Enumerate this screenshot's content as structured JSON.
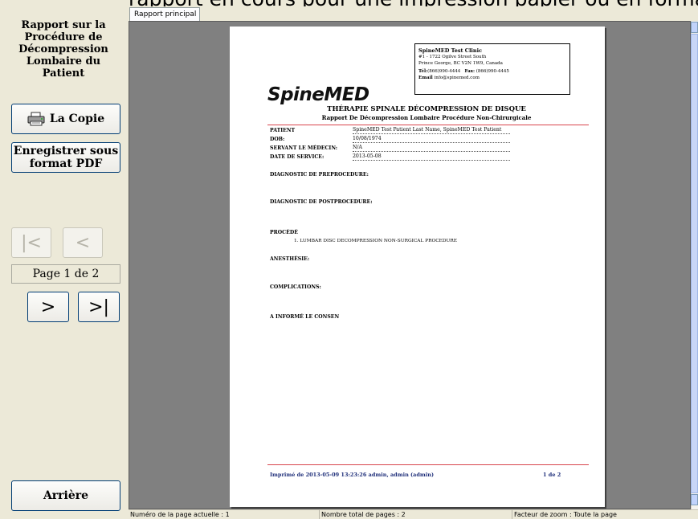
{
  "header": {
    "banner_text": "rapport en cours pour une impression papier ou en format PDF"
  },
  "sidebar": {
    "title": "Rapport sur la Procédure de Décompression Lombaire du Patient",
    "copy_label": "La Copie",
    "pdf_label": "Enregistrer sous format PDF",
    "first_label": "|<",
    "prev_label": "<",
    "page_indicator": "Page 1 de 2",
    "next_label": ">",
    "last_label": ">|",
    "back_label": "Arrière"
  },
  "tabs": [
    {
      "label": "Rapport principal"
    }
  ],
  "report": {
    "clinic": {
      "name": "SpineMED Test Clinic",
      "address1": "#1 - 1722 Ogilve Street South",
      "address2": "Prince George, BC V2N 1W9, Canada",
      "tel_label": "Tél:",
      "tel": "(866)990-4444",
      "fax_label": "Fax:",
      "fax": "(866)990-4445",
      "email_label": "Email",
      "email": "info@spinemed.com"
    },
    "logo_text": "SpineMED",
    "title": "THÉRAPIE SPINALE DÉCOMPRESSION DE DISQUE",
    "subtitle": "Rapport De Décompression Lombaire Procédure Non-Chirurgicale",
    "fields": {
      "patient_label": "PATIENT",
      "patient_value": "SpineMED Test Patient Last Name, SpineMED Test Patient",
      "dob_label": "DOB:",
      "dob_value": "10/08/1974",
      "doctor_label": "SERVANT LE MÉDECIN:",
      "doctor_value": "N/A",
      "service_label": "DATE DE SERVICE:",
      "service_value": "2013-05-08"
    },
    "sections": {
      "pre": "DIAGNOSTIC DE PREPROCEDURE:",
      "post": "DIAGNOSTIC DE POSTPROCEDURE:",
      "proc": "PROCÉDÉ",
      "proc_item": "1. LUMBAR DISC DECOMPRESSION NON-SURGICAL PROCEDURE",
      "anesthesia": "ANESTHÉSIE:",
      "complications": "COMPLICATIONS:",
      "consent": "A INFORMÉ LE CONSEN"
    },
    "footer": {
      "printed": "Imprimé de 2013-05-09 13:23:26  admin, admin (admin)",
      "page": "1 de 2"
    }
  },
  "statusbar": {
    "current_page": "Numéro de la page actuelle : 1",
    "total_pages": "Nombre total de pages : 2",
    "zoom": "Facteur de zoom : Toute la page"
  },
  "colors": {
    "accent_line": "#d8444c",
    "footer_text": "#1f2f7a",
    "viewer_bg": "#808080"
  }
}
